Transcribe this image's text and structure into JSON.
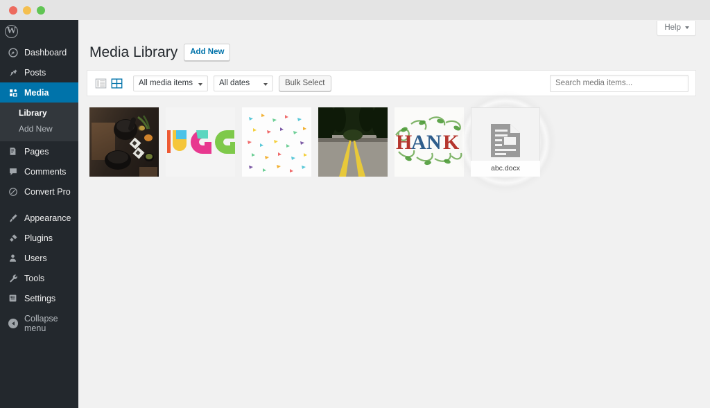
{
  "window": {
    "traffic_lights": [
      "close",
      "minimize",
      "maximize"
    ]
  },
  "sidebar": {
    "logo_icon": "wordpress-logo-icon",
    "logo_glyph": "W",
    "items": [
      {
        "label": "Dashboard",
        "icon": "dashboard-icon",
        "current": false
      },
      {
        "label": "Posts",
        "icon": "pin-icon",
        "current": false
      },
      {
        "label": "Media",
        "icon": "media-icon",
        "current": true
      },
      {
        "label": "Pages",
        "icon": "page-icon",
        "current": false
      },
      {
        "label": "Comments",
        "icon": "comment-icon",
        "current": false
      },
      {
        "label": "Convert Pro",
        "icon": "convert-pro-icon",
        "current": false
      },
      {
        "label": "Appearance",
        "icon": "brush-icon",
        "current": false
      },
      {
        "label": "Plugins",
        "icon": "plug-icon",
        "current": false
      },
      {
        "label": "Users",
        "icon": "user-icon",
        "current": false
      },
      {
        "label": "Tools",
        "icon": "wrench-icon",
        "current": false
      },
      {
        "label": "Settings",
        "icon": "settings-icon",
        "current": false
      }
    ],
    "media_submenu": [
      {
        "label": "Library",
        "current": true
      },
      {
        "label": "Add New",
        "current": false
      }
    ],
    "collapse": {
      "label": "Collapse menu",
      "icon": "collapse-icon"
    }
  },
  "screen_meta": {
    "help_label": "Help",
    "help_caret_icon": "chevron-down-icon"
  },
  "page": {
    "title": "Media Library",
    "add_new_label": "Add New"
  },
  "toolbar": {
    "list_view_icon": "list-view-icon",
    "grid_view_icon": "grid-view-icon",
    "active_view": "grid",
    "media_filter": {
      "value": "All media items",
      "caret_icon": "chevron-down-icon"
    },
    "date_filter": {
      "value": "All dates",
      "caret_icon": "chevron-down-icon"
    },
    "bulk_select_label": "Bulk Select",
    "search": {
      "placeholder": "Search media items...",
      "value": ""
    }
  },
  "media_grid": {
    "items": [
      {
        "name": "mortar-and-pestle-flatlay",
        "type": "image",
        "filename": ""
      },
      {
        "name": "ug-colorful-logo",
        "type": "image",
        "filename": ""
      },
      {
        "name": "confetti-pattern",
        "type": "image",
        "filename": ""
      },
      {
        "name": "forest-road",
        "type": "image",
        "filename": ""
      },
      {
        "name": "thank-ornate-lettering",
        "type": "image",
        "filename": ""
      },
      {
        "name": "abc-document",
        "type": "document",
        "filename": "abc.docx",
        "icon": "document-icon",
        "focused": true
      }
    ]
  },
  "colors": {
    "admin_bar": "#23282d",
    "submenu_bg": "#32373c",
    "accent_blue": "#0073aa",
    "content_bg": "#f1f1f1",
    "panel_white": "#ffffff"
  }
}
